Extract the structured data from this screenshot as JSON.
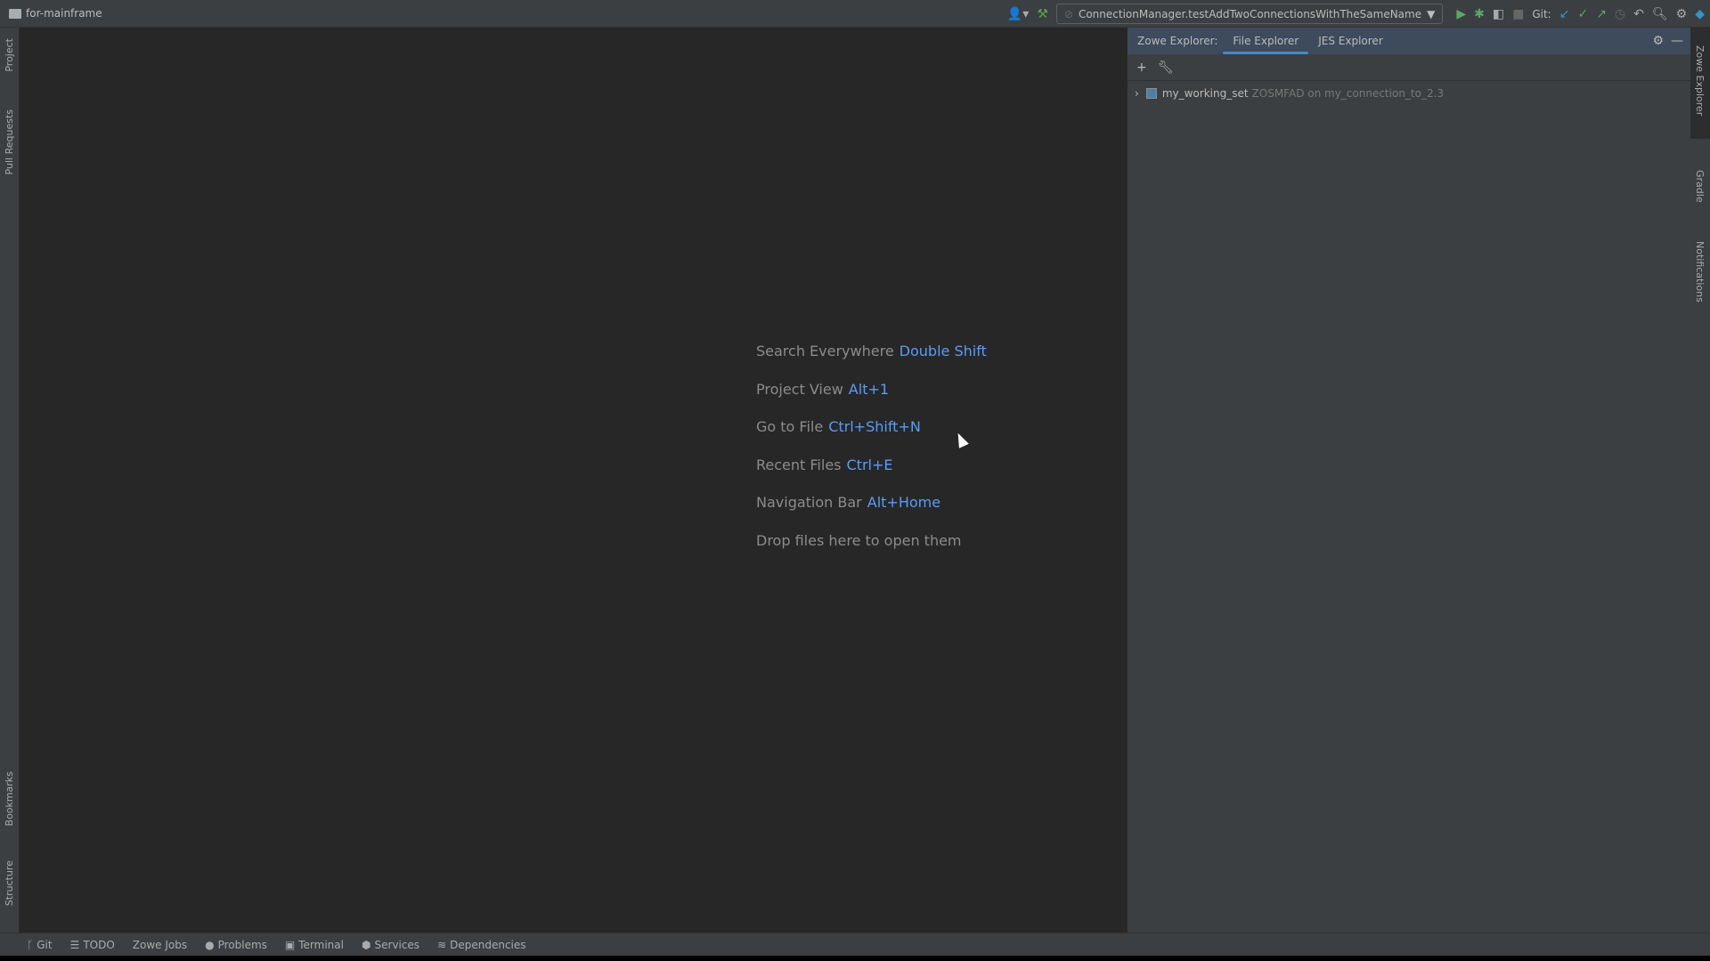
{
  "title_bar": {
    "project": "for-mainframe",
    "run_config": "ConnectionManager.testAddTwoConnectionsWithTheSameName",
    "git_label": "Git:"
  },
  "left_strip": {
    "top": [
      "Project",
      "Pull Requests"
    ],
    "bottom": [
      "Bookmarks",
      "Structure"
    ]
  },
  "right_strip": [
    "Zowe Explorer",
    "Gradle",
    "Notifications"
  ],
  "welcome": [
    {
      "label": "Search Everywhere",
      "shortcut": "Double Shift"
    },
    {
      "label": "Project View",
      "shortcut": "Alt+1"
    },
    {
      "label": "Go to File",
      "shortcut": "Ctrl+Shift+N"
    },
    {
      "label": "Recent Files",
      "shortcut": "Ctrl+E"
    },
    {
      "label": "Navigation Bar",
      "shortcut": "Alt+Home"
    },
    {
      "label": "Drop files here to open them",
      "shortcut": ""
    }
  ],
  "panel": {
    "title": "Zowe Explorer:",
    "tabs": [
      "File Explorer",
      "JES Explorer"
    ],
    "active_tab": "File Explorer",
    "tree": [
      {
        "name": "my_working_set",
        "detail": "ZOSMFAD on my_connection_to_2.3"
      }
    ]
  },
  "bottom_bar": [
    "Git",
    "TODO",
    "Zowe Jobs",
    "Problems",
    "Terminal",
    "Services",
    "Dependencies"
  ],
  "colors": {
    "accent": "#589df6",
    "editor_bg": "#272727",
    "panel_bg": "#3c3f41"
  }
}
